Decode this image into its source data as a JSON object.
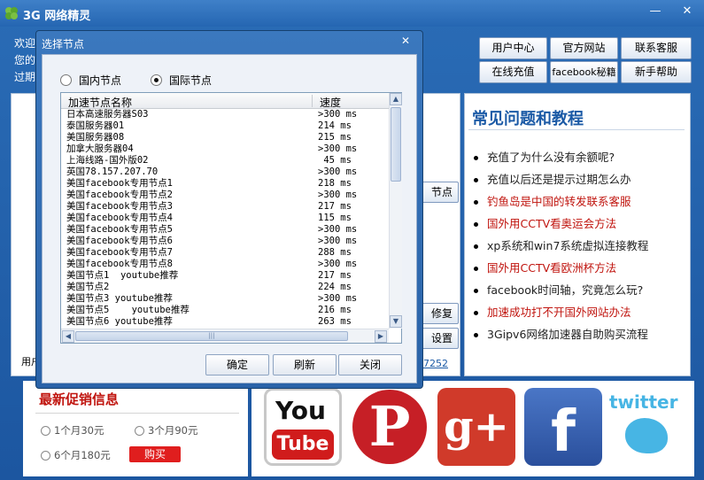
{
  "app": {
    "title": "3G 网络精灵",
    "min_glyph": "—",
    "close_glyph": "✕",
    "welcome_lines": [
      "欢迎",
      "您的",
      "过期"
    ],
    "top_buttons": {
      "user_center": "用户中心",
      "official": "官方网站",
      "contact": "联系客服",
      "recharge": "在线充值",
      "fb_secret": "facebook秘籍",
      "help": "新手帮助"
    },
    "side_buttons": {
      "node": "节点",
      "repair": "修复",
      "settings": "设置"
    },
    "user_fragment": "用户",
    "link_fragment": "7252"
  },
  "faq": {
    "title": "常见问题和教程",
    "items": [
      {
        "text": "充值了为什么没有余额呢?",
        "color": "#222222"
      },
      {
        "text": "充值以后还是提示过期怎么办",
        "color": "#222222"
      },
      {
        "text": "钓鱼岛是中国的转发联系客服",
        "color": "#c0140e"
      },
      {
        "text": "国外用CCTV看奥运会方法",
        "color": "#c0140e"
      },
      {
        "text": "xp系统和win7系统虚拟连接教程",
        "color": "#222222"
      },
      {
        "text": "国外用CCTV看欧洲杯方法",
        "color": "#c0140e"
      },
      {
        "text": "facebook时间轴，究竟怎么玩?",
        "color": "#222222"
      },
      {
        "text": "加速成功打不开国外网站办法",
        "color": "#c0140e"
      },
      {
        "text": "3Gipv6网络加速器自助购买流程",
        "color": "#222222"
      }
    ]
  },
  "promo": {
    "title": "最新促销信息",
    "opt_1m": "1个月30元",
    "opt_3m": "3个月90元",
    "opt_6m": "6个月180元",
    "buy": "购买"
  },
  "social": {
    "youtube_you": "You",
    "youtube_tube": "Tube",
    "pinterest": "P",
    "gplus": "g+",
    "facebook": "f",
    "twitter": "twitter",
    "icons": [
      "youtube-icon",
      "pinterest-icon",
      "google-plus-icon",
      "facebook-icon",
      "twitter-icon"
    ]
  },
  "dialog": {
    "title": "选择节点",
    "close_glyph": "✕",
    "radio_domestic": "国内节点",
    "radio_international": "国际节点",
    "selected": "国际节点",
    "col_name": "加速节点名称",
    "col_speed": "速度",
    "nodes": [
      {
        "name": "日本高速服务器S03",
        "speed": ">300 ms"
      },
      {
        "name": "泰国服务器01",
        "speed": "214 ms"
      },
      {
        "name": "美国服务器08",
        "speed": "215 ms"
      },
      {
        "name": "加拿大服务器04",
        "speed": ">300 ms"
      },
      {
        "name": "上海线路-国外版02",
        "speed": " 45 ms"
      },
      {
        "name": "英国78.157.207.70",
        "speed": ">300 ms"
      },
      {
        "name": "美国facebook专用节点1",
        "speed": "218 ms"
      },
      {
        "name": "美国facebook专用节点2",
        "speed": ">300 ms"
      },
      {
        "name": "美国facebook专用节点3",
        "speed": "217 ms"
      },
      {
        "name": "美国facebook专用节点4",
        "speed": "115 ms"
      },
      {
        "name": "美国facebook专用节点5",
        "speed": ">300 ms"
      },
      {
        "name": "美国facebook专用节点6",
        "speed": ">300 ms"
      },
      {
        "name": "美国facebook专用节点7",
        "speed": "288 ms"
      },
      {
        "name": "美国facebook专用节点8",
        "speed": ">300 ms"
      },
      {
        "name": "美国节点1  youtube推荐",
        "speed": "217 ms"
      },
      {
        "name": "美国节点2",
        "speed": "224 ms"
      },
      {
        "name": "美国节点3 youtube推荐",
        "speed": ">300 ms"
      },
      {
        "name": "美国节点5    youtube推荐",
        "speed": "216 ms"
      },
      {
        "name": "美国节点6 youtube推荐",
        "speed": "263 ms"
      }
    ],
    "btn_ok": "确定",
    "btn_refresh": "刷新",
    "btn_close": "关闭"
  }
}
